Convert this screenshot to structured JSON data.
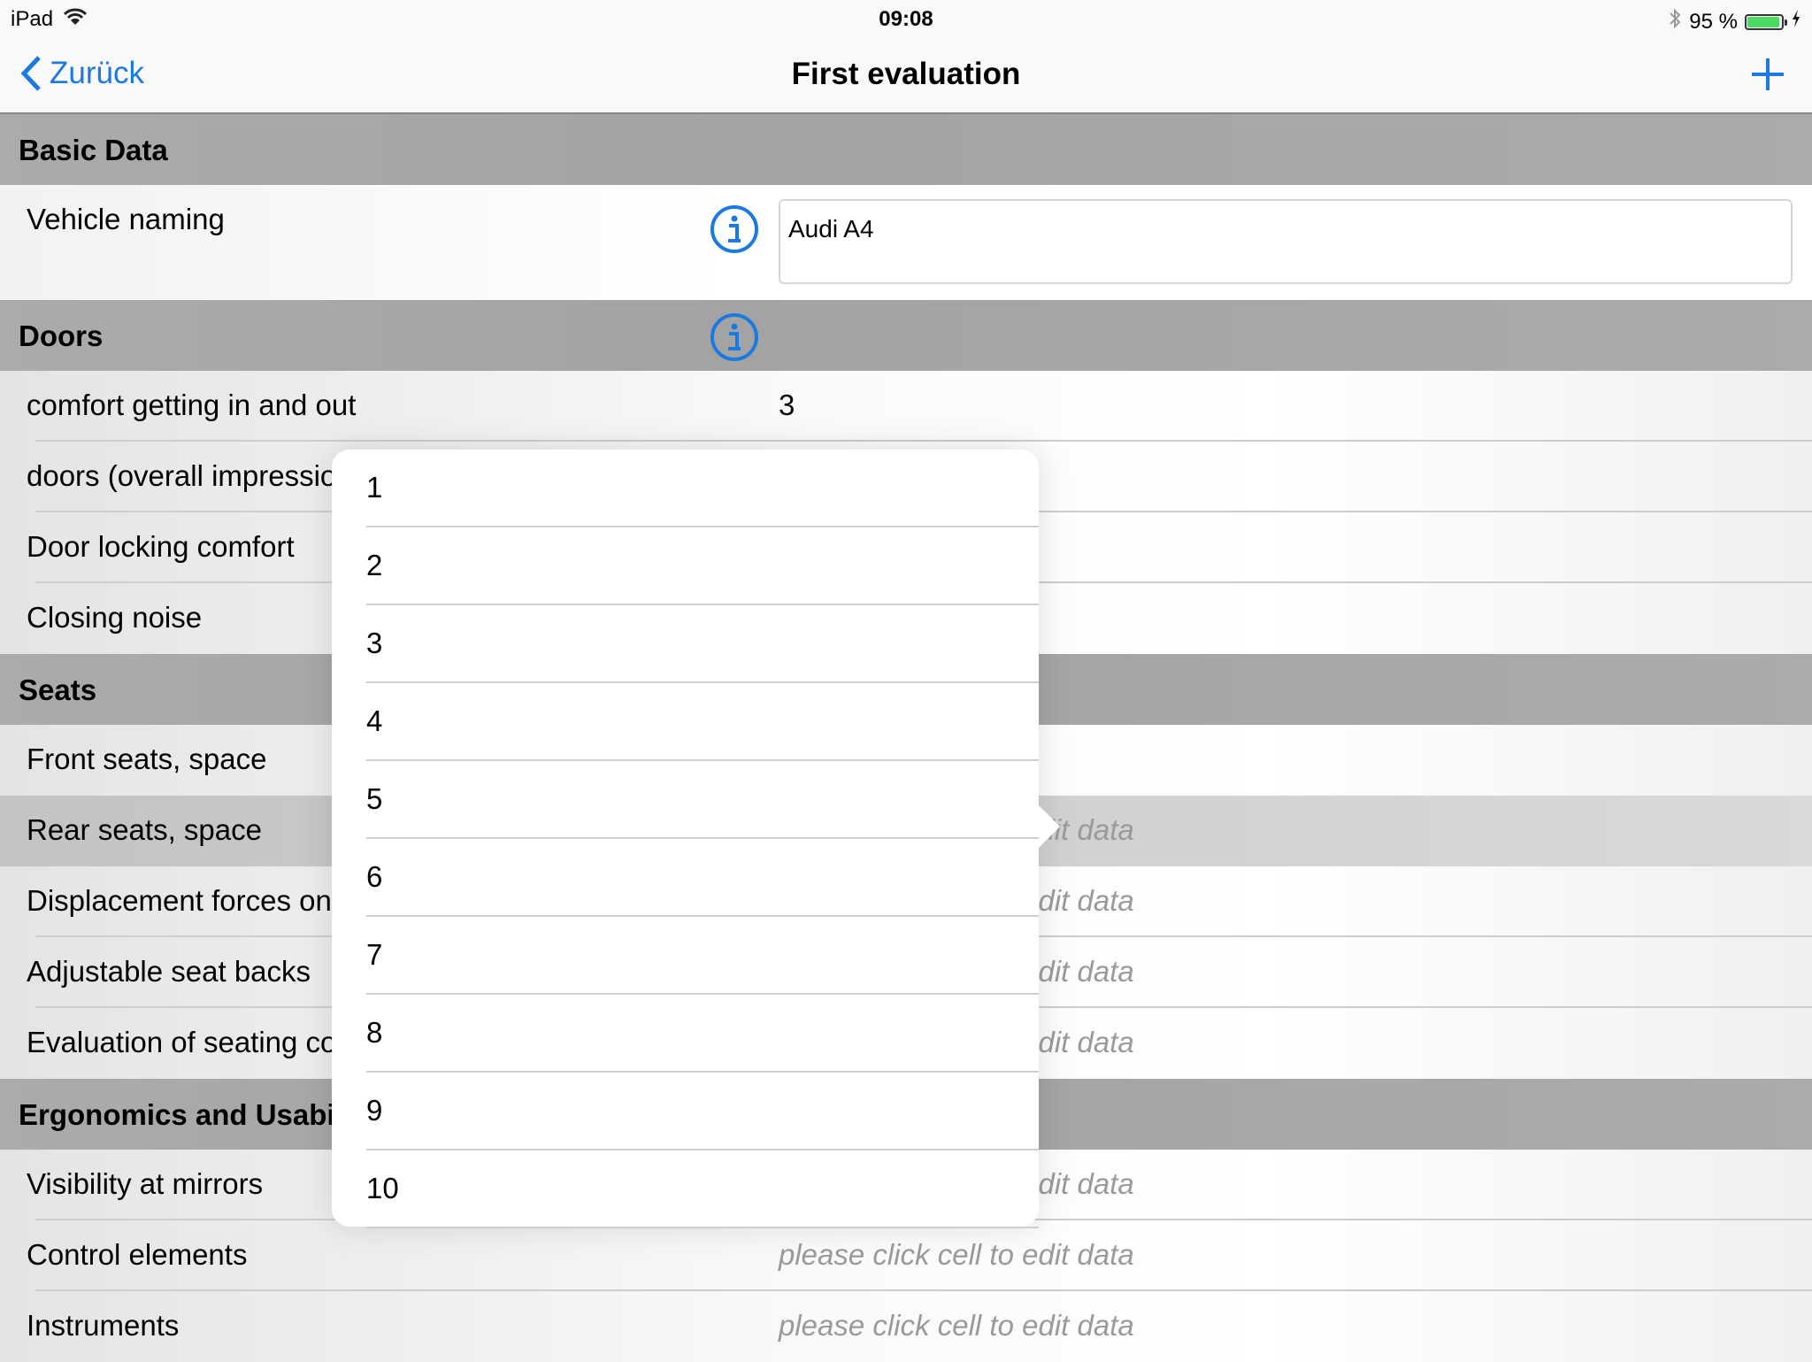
{
  "status_bar": {
    "device": "iPad",
    "wifi_icon": "wifi-icon",
    "time": "09:08",
    "bluetooth_icon": "bluetooth-icon",
    "battery_percent": "95 %",
    "battery_level": 0.95,
    "charging_icon": "bolt-icon"
  },
  "nav": {
    "back_label": "Zurück",
    "title": "First evaluation",
    "add_icon": "plus-icon"
  },
  "colors": {
    "accent": "#1a7ae0",
    "section_bg": "#a8a8a8",
    "placeholder": "#9a9a9a",
    "battery": "#4cd964"
  },
  "sections": [
    {
      "title": "Basic Data",
      "rows": [
        {
          "label": "Vehicle naming",
          "value": "Audi A4",
          "type": "textfield"
        }
      ]
    },
    {
      "title": "Doors",
      "rows": [
        {
          "label": "comfort getting in and out",
          "value": "3"
        },
        {
          "label": "doors (overall impression)",
          "value": ""
        },
        {
          "label": "Door locking comfort",
          "value": ""
        },
        {
          "label": "Closing noise",
          "value": ""
        }
      ]
    },
    {
      "title": "Seats",
      "rows": [
        {
          "label": "Front seats, space",
          "value": ""
        },
        {
          "label": "Rear seats, space",
          "placeholder": "please click cell to edit data",
          "selected": true
        },
        {
          "label": "Displacement forces on seats",
          "placeholder": "please click cell to edit data"
        },
        {
          "label": "Adjustable seat backs",
          "placeholder": "please click cell to edit data"
        },
        {
          "label": "Evaluation of seating comfort",
          "placeholder": "please click cell to edit data"
        }
      ]
    },
    {
      "title": "Ergonomics and Usability",
      "rows": [
        {
          "label": "Visibility at mirrors",
          "placeholder": "please click cell to edit data"
        },
        {
          "label": "Control elements",
          "placeholder": "please click cell to edit data"
        },
        {
          "label": "Instruments",
          "placeholder": "please click cell to edit data"
        }
      ]
    }
  ],
  "picker": {
    "options": [
      "1",
      "2",
      "3",
      "4",
      "5",
      "6",
      "7",
      "8",
      "9",
      "10"
    ]
  }
}
